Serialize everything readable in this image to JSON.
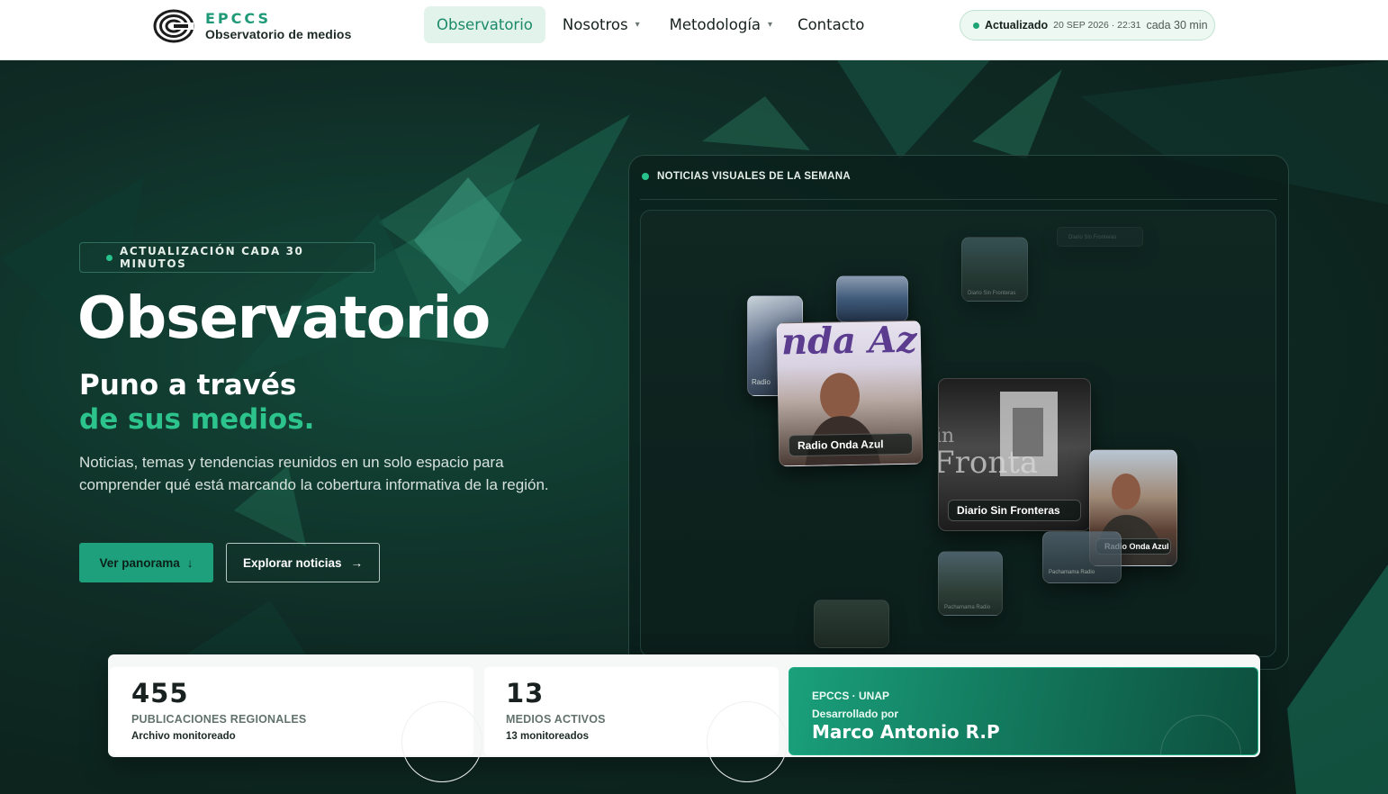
{
  "header": {
    "brand": {
      "name": "EPCCS",
      "tagline": "Observatorio de medios"
    },
    "nav": [
      {
        "label": "Observatorio",
        "active": true,
        "has_dropdown": false
      },
      {
        "label": "Nosotros",
        "active": false,
        "has_dropdown": true
      },
      {
        "label": "Metodología",
        "active": false,
        "has_dropdown": true
      },
      {
        "label": "Contacto",
        "active": false,
        "has_dropdown": false
      }
    ],
    "status": {
      "label": "Actualizado",
      "date": "20 SEP 2026 · 22:31",
      "frequency": "cada 30 min"
    }
  },
  "hero": {
    "badge": "ACTUALIZACIÓN CADA 30 MINUTOS",
    "title": "Observatorio",
    "subtitle_line1": "Puno a través",
    "subtitle_line2": "de sus medios.",
    "description": "Noticias, temas y tendencias reunidos en un solo espacio para comprender qué está marcando la cobertura informativa de la región.",
    "primary_button": {
      "label": "Ver panorama",
      "icon": "arrow-down-icon",
      "glyph": "↓"
    },
    "secondary_button": {
      "label": "Explorar noticias",
      "icon": "arrow-right-icon",
      "glyph": "→"
    }
  },
  "visual_panel": {
    "title": "NOTICIAS VISUALES DE LA SEMANA",
    "cards": [
      {
        "label": "Radio Onda Azul",
        "size": "large"
      },
      {
        "label": "Diario Sin Fronteras",
        "size": "large"
      },
      {
        "label": "Radio Onda Azul",
        "size": "medium"
      },
      {
        "label": "Radio",
        "size": "partial"
      },
      {
        "label": "Diario Sin Fronteras",
        "size": "small"
      },
      {
        "label": "Pachamama Radio",
        "size": "small"
      },
      {
        "label": "Pachamama Radio",
        "size": "small"
      },
      {
        "label": "Diario Sin Fronteras",
        "size": "faded"
      }
    ]
  },
  "stats": [
    {
      "value": "455",
      "label": "PUBLICACIONES REGIONALES",
      "note": "Archivo monitoreado"
    },
    {
      "value": "13",
      "label": "MEDIOS ACTIVOS",
      "note": "13 monitoreados"
    }
  ],
  "credit": {
    "org": "EPCCS · UNAP",
    "by": "Desarrollado por",
    "name": "Marco Antonio R.P"
  },
  "colors": {
    "accent": "#1fa07d",
    "accent_light": "#2cc48c",
    "dark_bg": "#0b1c17",
    "white": "#ffffff"
  }
}
